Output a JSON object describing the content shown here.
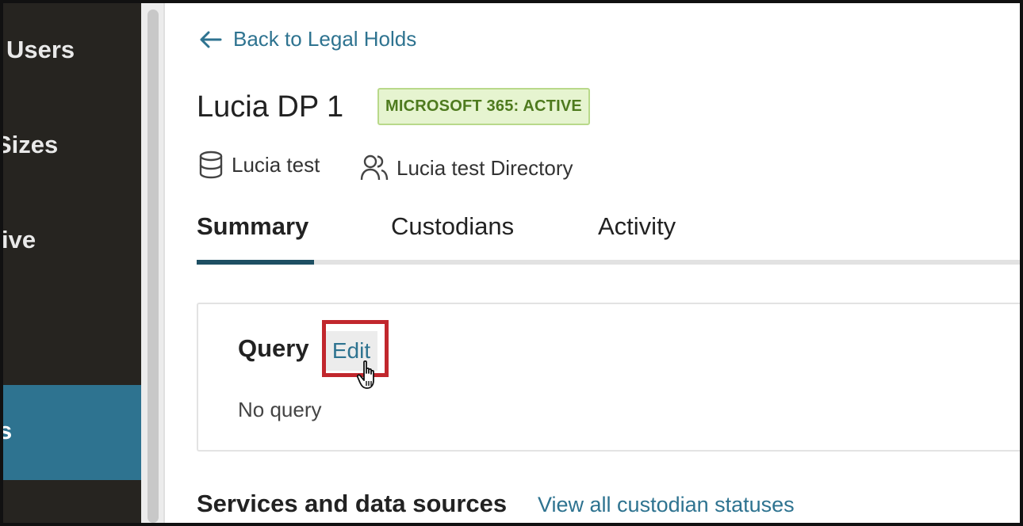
{
  "sidebar": {
    "items": [
      {
        "label": "Users"
      },
      {
        "label": "Sizes"
      },
      {
        "label": "ive"
      },
      {
        "label": "s"
      }
    ]
  },
  "header": {
    "back_label": "Back to Legal Holds",
    "title": "Lucia DP 1",
    "badge": "MICROSOFT 365: ACTIVE",
    "database": "Lucia test",
    "directory": "Lucia test Directory"
  },
  "tabs": [
    {
      "label": "Summary",
      "active": true
    },
    {
      "label": "Custodians",
      "active": false
    },
    {
      "label": "Activity",
      "active": false
    }
  ],
  "query_card": {
    "title": "Query",
    "edit_label": "Edit",
    "empty_text": "No query"
  },
  "services": {
    "title": "Services and data sources",
    "link_label": "View all custodian statuses"
  },
  "colors": {
    "accent": "#2e7390",
    "sidebar_bg": "#262420",
    "badge_bg": "#e6f4d0",
    "badge_text": "#4e7a1e",
    "highlight": "#c1272d"
  }
}
